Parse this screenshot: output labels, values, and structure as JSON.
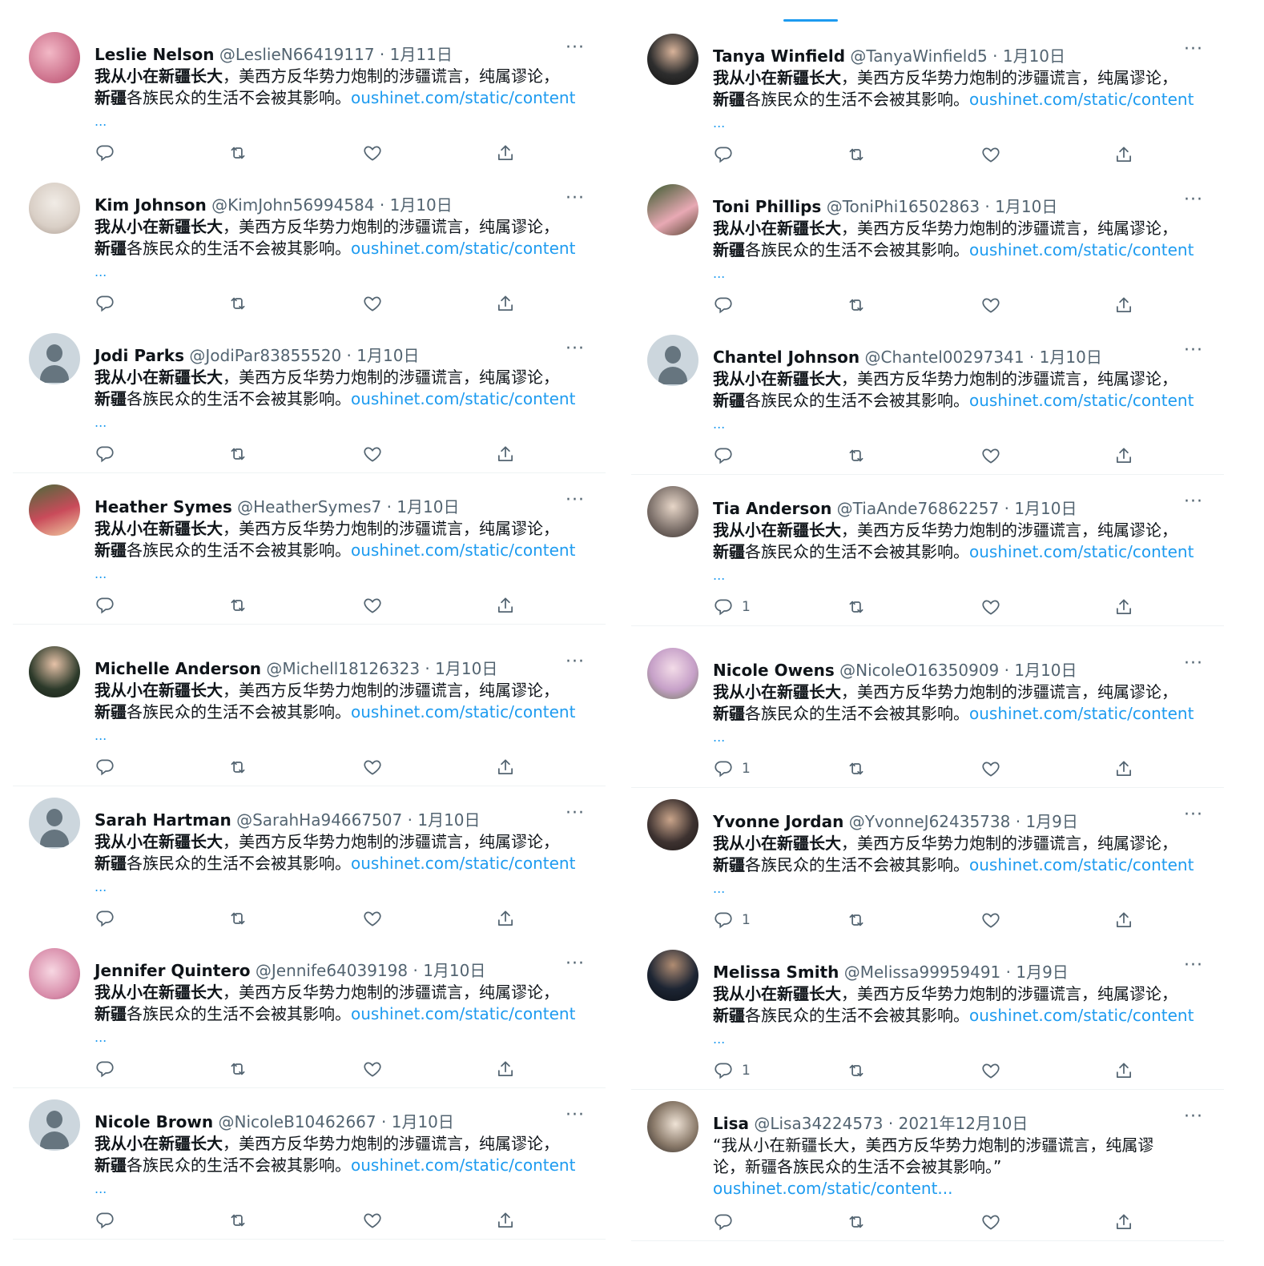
{
  "text": {
    "bold1": "我从小在新疆长大",
    "mid": "，美西方反华势力炮制的涉疆谎言，纯属谬论，",
    "bold2": "新疆",
    "end": "各族民众的生活不会被其影响。",
    "link": "oushinet.com/static/content",
    "ellipsis": "..."
  },
  "left": [
    {
      "name": "Leslie Nelson",
      "handle": "@LeslieN66419117",
      "date": "1月11日",
      "avatar": "photo"
    },
    {
      "name": "Kim Johnson",
      "handle": "@KimJohn56994584",
      "date": "1月10日",
      "avatar": "photo"
    },
    {
      "name": "Jodi Parks",
      "handle": "@JodiPar83855520",
      "date": "1月10日",
      "avatar": "default"
    },
    {
      "name": "Heather Symes",
      "handle": "@HeatherSymes7",
      "date": "1月10日",
      "avatar": "photo"
    },
    {
      "name": "Michelle Anderson",
      "handle": "@Michell18126323",
      "date": "1月10日",
      "avatar": "photo"
    },
    {
      "name": "Sarah Hartman",
      "handle": "@SarahHa94667507",
      "date": "1月10日",
      "avatar": "default"
    },
    {
      "name": "Jennifer Quintero",
      "handle": "@Jennife64039198",
      "date": "1月10日",
      "avatar": "photo"
    },
    {
      "name": "Nicole Brown",
      "handle": "@NicoleB10462667",
      "date": "1月10日",
      "avatar": "default"
    }
  ],
  "right": [
    {
      "name": "Tanya Winfield",
      "handle": "@TanyaWinfield5",
      "date": "1月10日",
      "avatar": "photo",
      "replies": ""
    },
    {
      "name": "Toni Phillips",
      "handle": "@ToniPhi16502863",
      "date": "1月10日",
      "avatar": "photo",
      "replies": ""
    },
    {
      "name": "Chantel Johnson",
      "handle": "@Chantel00297341",
      "date": "1月10日",
      "avatar": "default",
      "replies": ""
    },
    {
      "name": "Tia Anderson",
      "handle": "@TiaAnde76862257",
      "date": "1月10日",
      "avatar": "photo",
      "replies": "1"
    },
    {
      "name": "Nicole Owens",
      "handle": "@NicoleO16350909",
      "date": "1月10日",
      "avatar": "photo",
      "replies": "1"
    },
    {
      "name": "Yvonne Jordan",
      "handle": "@YvonneJ62435738",
      "date": "1月9日",
      "avatar": "photo",
      "replies": "1"
    },
    {
      "name": "Melissa Smith",
      "handle": "@Melissa99959491",
      "date": "1月9日",
      "avatar": "photo",
      "replies": "1"
    },
    {
      "name": "Lisa",
      "handle": "@Lisa34224573",
      "date": "2021年12月10日",
      "avatar": "photo",
      "replies": "",
      "quoted": {
        "line1": "“我从小在新疆长大，美西方反华势力炮制的涉疆谎言，纯属谬",
        "line2": "论，新疆各族民众的生活不会被其影响。”",
        "link": "oushinet.com/static/content..."
      }
    }
  ],
  "separator": " · ",
  "more_label": "···",
  "icons": {
    "reply": "reply-icon",
    "retweet": "retweet-icon",
    "like": "like-icon",
    "share": "share-icon",
    "more": "more-icon"
  },
  "colors": {
    "link": "#1d9bf0",
    "secondary": "#536471",
    "text": "#0f1419",
    "divider": "#eff3f4"
  }
}
